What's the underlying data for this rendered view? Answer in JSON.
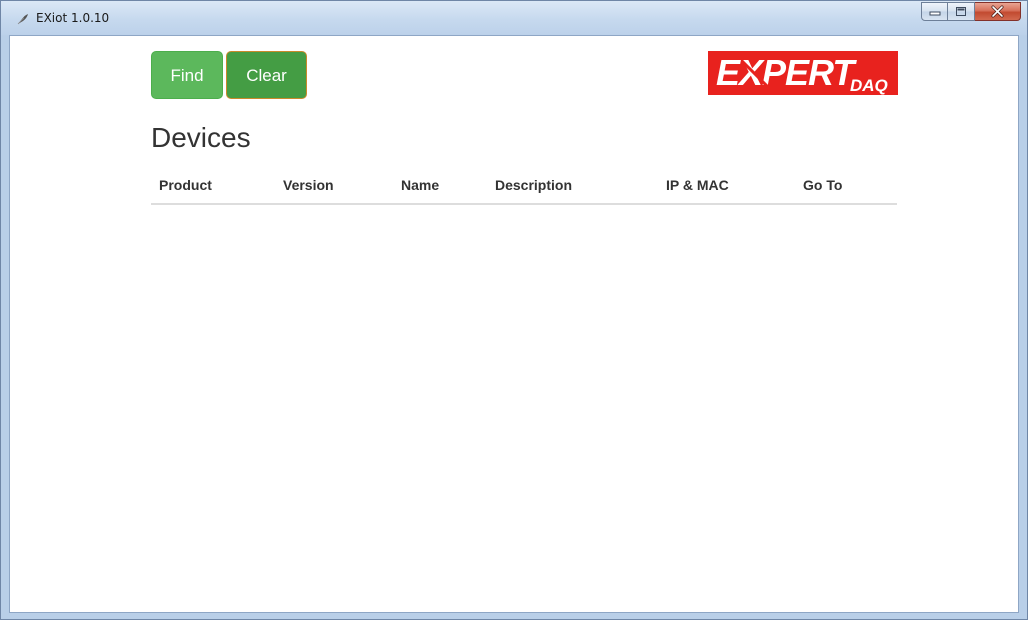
{
  "window": {
    "title": "EXiot 1.0.10"
  },
  "toolbar": {
    "find_label": "Find",
    "clear_label": "Clear"
  },
  "logo": {
    "text_main": "EXPERT",
    "text_sub": "DAQ",
    "brand_color": "#e8221e"
  },
  "page": {
    "title": "Devices"
  },
  "devices_table": {
    "columns": [
      "Product",
      "Version",
      "Name",
      "Description",
      "IP & MAC",
      "Go To"
    ],
    "rows": []
  },
  "colors": {
    "find_button": "#5cb85c",
    "clear_button": "#449d44",
    "clear_button_border": "#c98a2b",
    "table_divider": "#dddddd"
  },
  "icons": {
    "app": "feather-icon",
    "minimize": "minimize-icon",
    "maximize": "maximize-icon",
    "close": "close-icon"
  }
}
